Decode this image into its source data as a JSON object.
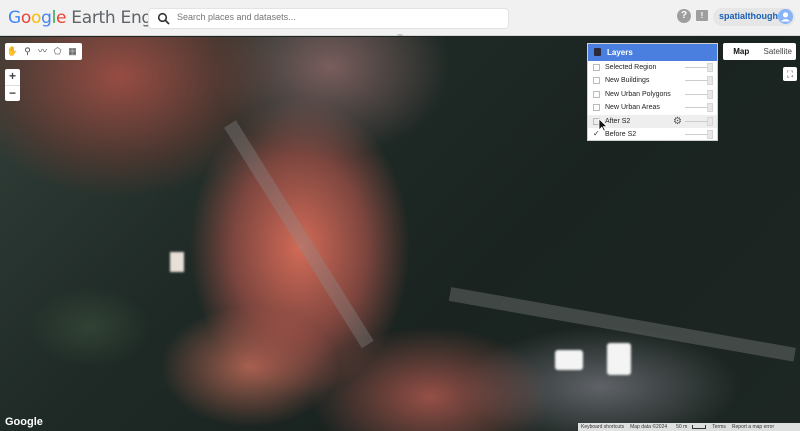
{
  "header": {
    "logo_google": "Google",
    "logo_rest": " Earth Engine",
    "search_placeholder": "Search places and datasets...",
    "help_icon": "help-icon",
    "feedback_icon": "feedback-icon",
    "username": "spatialthoughts"
  },
  "tools": [
    {
      "icon": "hand-pan-icon",
      "glyph": "✋"
    },
    {
      "icon": "point-marker-icon",
      "glyph": "⚲"
    },
    {
      "icon": "line-draw-icon",
      "glyph": "〰"
    },
    {
      "icon": "polygon-draw-icon",
      "glyph": "⬠"
    },
    {
      "icon": "rectangle-draw-icon",
      "glyph": "▦"
    }
  ],
  "zoom": {
    "in": "+",
    "out": "−"
  },
  "layers": {
    "title": "Layers",
    "items": [
      {
        "label": "Selected Region",
        "checked": false
      },
      {
        "label": "New Buildings",
        "checked": false
      },
      {
        "label": "New Urban Polygons",
        "checked": false
      },
      {
        "label": "New Urban Areas",
        "checked": false
      },
      {
        "label": "After S2",
        "checked": false
      },
      {
        "label": "Before S2",
        "checked": true
      }
    ]
  },
  "maptype": {
    "map": "Map",
    "satellite": "Satellite",
    "active": "Map"
  },
  "footer": {
    "google_logo": "Google",
    "keyboard": "Keyboard shortcuts",
    "map_data": "Map data ©2024",
    "scale": "50 m",
    "terms": "Terms",
    "report": "Report a map error"
  }
}
